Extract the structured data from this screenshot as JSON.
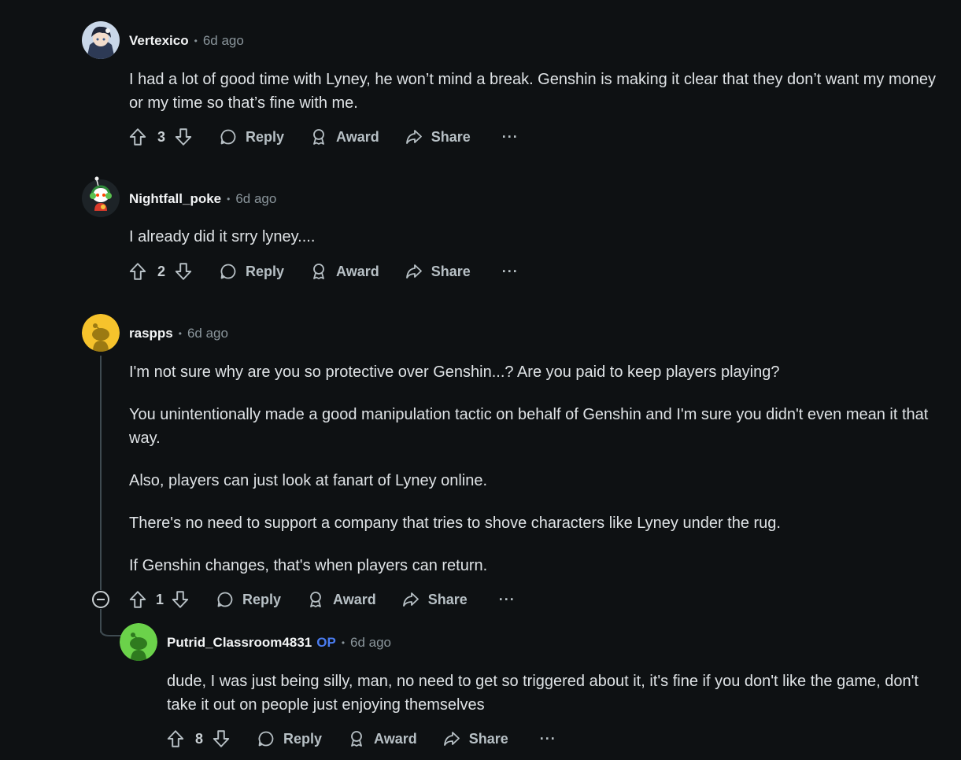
{
  "comments": [
    {
      "author": "Vertexico",
      "time": "6d ago",
      "avatar": "anime-character-avatar",
      "body": [
        "I had a lot of good time with Lyney, he won’t mind a break. Genshin is making it clear that they don’t want my money or my time so that’s fine with me."
      ],
      "score": "3",
      "reply": "Reply",
      "award": "Award",
      "share": "Share",
      "more": "···"
    },
    {
      "author": "Nightfall_poke",
      "time": "6d ago",
      "avatar": "snoo-headphones-avatar",
      "body": [
        "I already did it srry lyney...."
      ],
      "score": "2",
      "reply": "Reply",
      "award": "Award",
      "share": "Share",
      "more": "···"
    },
    {
      "author": "raspps",
      "time": "6d ago",
      "avatar": "default-snoo-avatar-yellow",
      "body": [
        "I'm not sure why are you so protective over Genshin...? Are you paid to keep players playing?",
        "You unintentionally made a good manipulation tactic on behalf of Genshin and I'm sure you didn't even mean it that way.",
        "Also, players can just look at fanart of Lyney online.",
        "There's no need to support a company that tries to shove characters like Lyney under the rug.",
        "If Genshin changes, that's when players can return."
      ],
      "score": "1",
      "reply": "Reply",
      "award": "Award",
      "share": "Share",
      "more": "···"
    },
    {
      "author": "Putrid_Classroom4831",
      "op": "OP",
      "time": "6d ago",
      "avatar": "default-snoo-avatar-green",
      "body": [
        "dude, I was just being silly, man, no need to get so triggered about it, it's fine if you don't like the game, don't take it out on people just enjoying themselves"
      ],
      "score": "8",
      "reply": "Reply",
      "award": "Award",
      "share": "Share",
      "more": "···"
    }
  ],
  "colors": {
    "background": "#0e1113",
    "text": "#dfe3e6",
    "muted": "#8a959b",
    "op_badge": "#4a7cf0",
    "thread_line": "#3e4a50"
  }
}
